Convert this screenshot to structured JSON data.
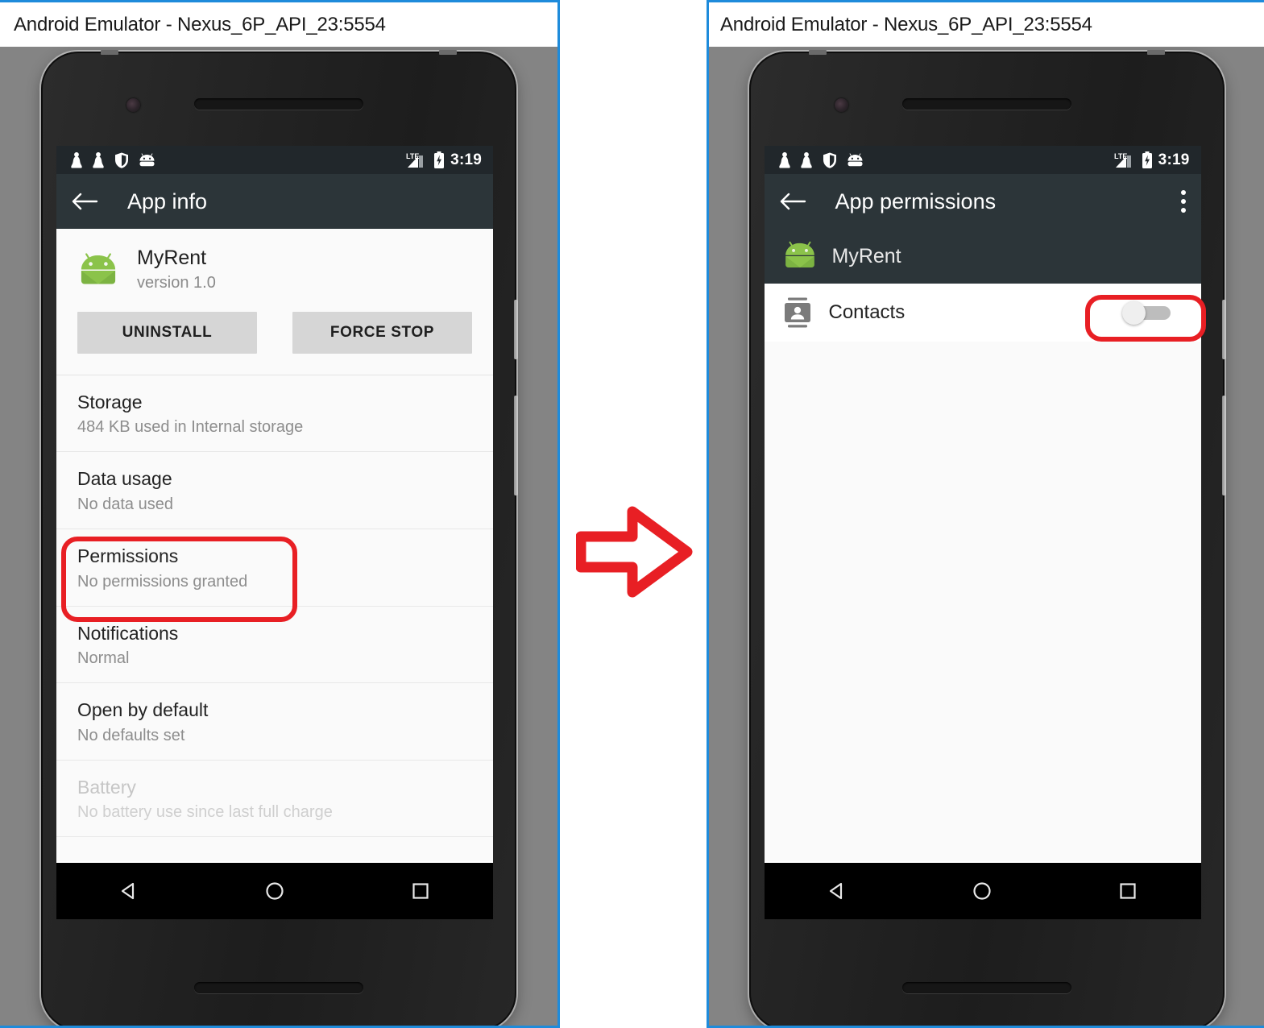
{
  "windows": [
    {
      "id": "left",
      "title": "Android Emulator - Nexus_6P_API_23:5554",
      "statusbar": {
        "icons": [
          "person-silhouette-icon",
          "person-silhouette-icon",
          "shield-icon",
          "android-head-icon"
        ],
        "network_label": "LTE",
        "signal_icon": "signal-bars-icon",
        "battery_icon": "battery-charging-icon",
        "time": "3:19"
      },
      "appbar": {
        "back_icon": "back-arrow-icon",
        "title": "App info"
      },
      "app": {
        "icon": "android-app-icon",
        "name": "MyRent",
        "version": "version 1.0"
      },
      "buttons": [
        {
          "label": "UNINSTALL",
          "name": "uninstall-button"
        },
        {
          "label": "FORCE STOP",
          "name": "force-stop-button"
        }
      ],
      "list": [
        {
          "title": "Storage",
          "sub": "484 KB used in Internal storage",
          "disabled": false,
          "highlighted": false
        },
        {
          "title": "Data usage",
          "sub": "No data used",
          "disabled": false,
          "highlighted": false
        },
        {
          "title": "Permissions",
          "sub": "No permissions granted",
          "disabled": false,
          "highlighted": true
        },
        {
          "title": "Notifications",
          "sub": "Normal",
          "disabled": false,
          "highlighted": false
        },
        {
          "title": "Open by default",
          "sub": "No defaults set",
          "disabled": false,
          "highlighted": false
        },
        {
          "title": "Battery",
          "sub": "No battery use since last full charge",
          "disabled": true,
          "highlighted": false
        }
      ],
      "navbar": [
        "back-nav-icon",
        "home-nav-icon",
        "recents-nav-icon"
      ]
    },
    {
      "id": "right",
      "title": "Android Emulator - Nexus_6P_API_23:5554",
      "statusbar": {
        "icons": [
          "person-silhouette-icon",
          "person-silhouette-icon",
          "shield-icon",
          "android-head-icon"
        ],
        "network_label": "LTE",
        "signal_icon": "signal-bars-icon",
        "battery_icon": "battery-charging-icon",
        "time": "3:19"
      },
      "appbar": {
        "back_icon": "back-arrow-icon",
        "title": "App permissions",
        "overflow_icon": "overflow-menu-icon"
      },
      "app": {
        "icon": "android-app-icon",
        "name": "MyRent"
      },
      "permissions": [
        {
          "icon": "contacts-card-icon",
          "label": "Contacts",
          "toggle_state": "off",
          "highlighted": true
        }
      ],
      "navbar": [
        "back-nav-icon",
        "home-nav-icon",
        "recents-nav-icon"
      ]
    }
  ],
  "annotations": {
    "arrow": {
      "name": "flow-arrow-right",
      "direction": "right"
    },
    "color": "#e81f24"
  },
  "colors": {
    "window_border": "#1e8bdb",
    "emulator_bg": "#848484",
    "statusbar_bg": "#21272b",
    "appbar_bg": "#2c3539",
    "content_bg": "#fafafa",
    "android_green": "#8bc34a",
    "annotation_red": "#e81f24"
  }
}
